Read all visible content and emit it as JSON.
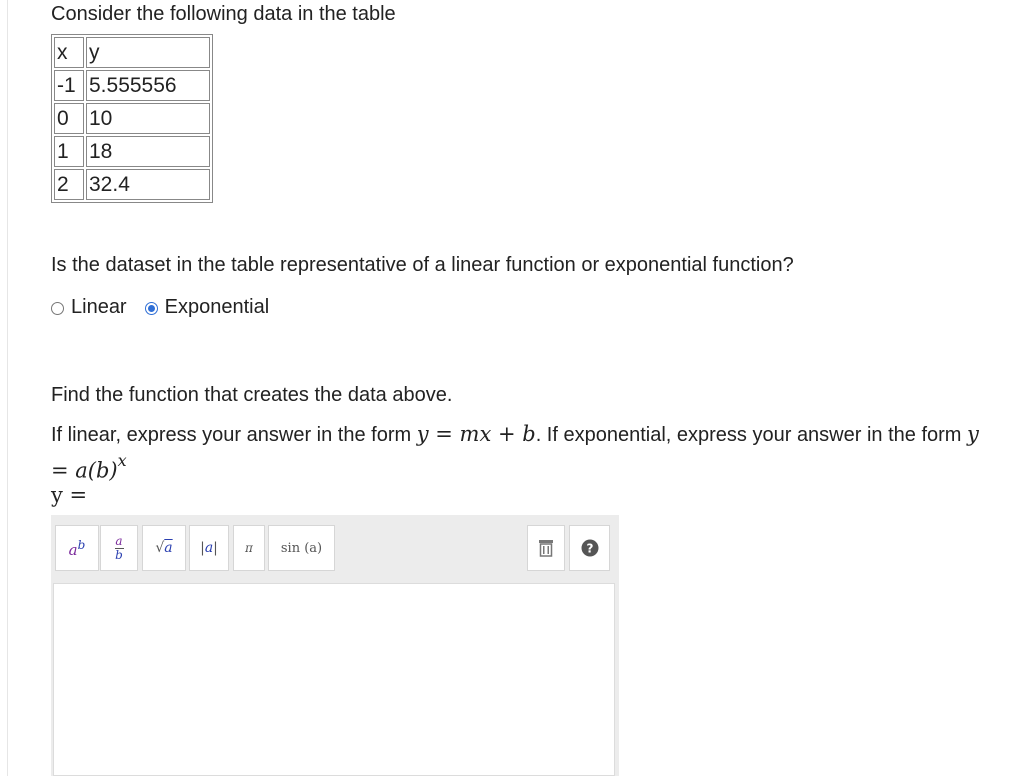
{
  "question": {
    "intro": "Consider the following data in the table",
    "table": {
      "headers": [
        "x",
        "y"
      ],
      "rows": [
        [
          "-1",
          "5.555556"
        ],
        [
          "0",
          "10"
        ],
        [
          "1",
          "18"
        ],
        [
          "2",
          "32.4"
        ]
      ]
    },
    "type_prompt": "Is the dataset in the table representative of a linear function or exponential function?",
    "options": [
      {
        "label": "Linear",
        "selected": false
      },
      {
        "label": "Exponential",
        "selected": true
      }
    ],
    "find_prompt": "Find the function that creates the data above.",
    "instructions": {
      "part1": "If linear, express your answer in the form ",
      "linear_form": "y = mx + b",
      "part2": ". If exponential, express your answer in the form ",
      "exp_form_base": "y = a(b)",
      "exp_form_exp": "x"
    },
    "answer_label": "y ="
  },
  "editor": {
    "buttons": [
      {
        "name": "power-button",
        "icon": "power-icon"
      },
      {
        "name": "fraction-button",
        "icon": "fraction-icon"
      },
      {
        "name": "sqrt-button",
        "icon": "sqrt-icon"
      },
      {
        "name": "abs-button",
        "icon": "abs-icon"
      },
      {
        "name": "pi-button",
        "label": "π"
      },
      {
        "name": "sin-button",
        "label": "sin (a)"
      },
      {
        "name": "clear-button",
        "icon": "trash-icon"
      },
      {
        "name": "help-button",
        "icon": "help-icon"
      }
    ],
    "accent_color": "#2f6fd6",
    "answer_value": ""
  }
}
